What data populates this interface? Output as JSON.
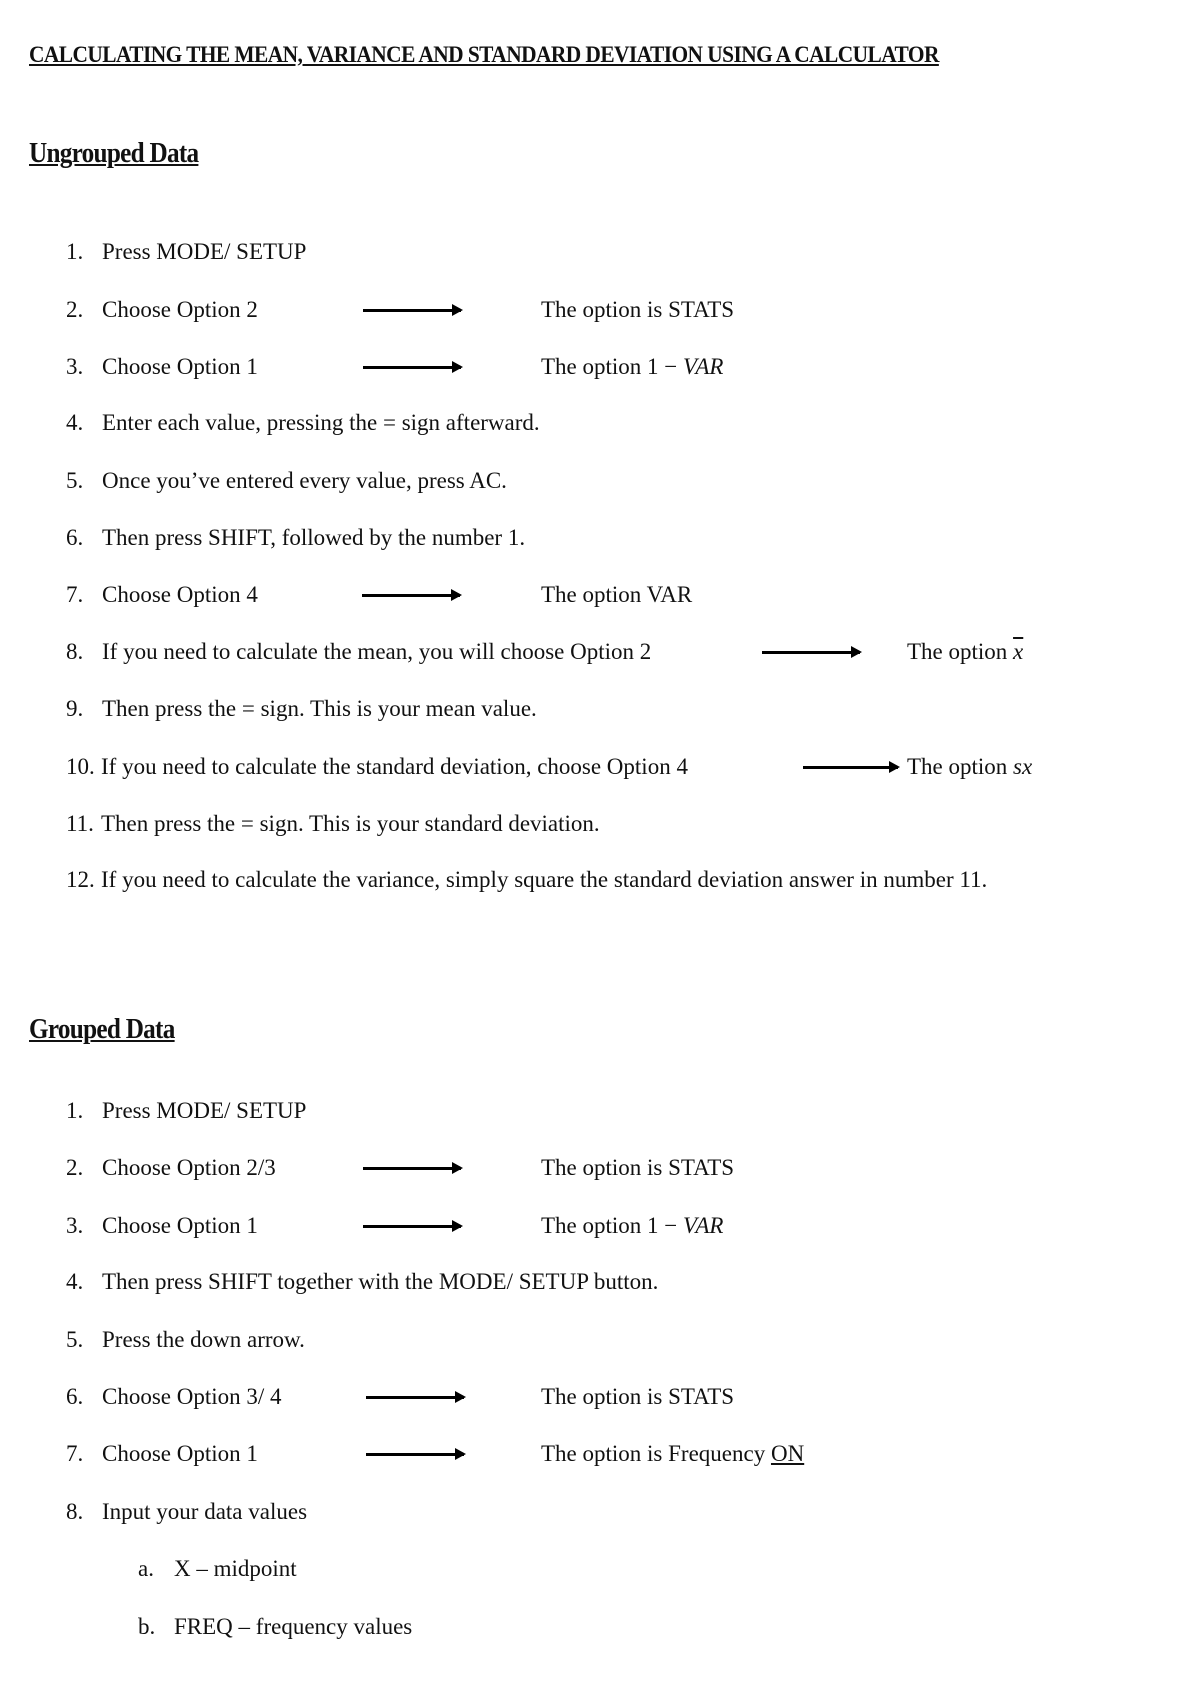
{
  "title": "CALCULATING THE MEAN, VARIANCE AND STANDARD DEVIATION USING A CALCULATOR",
  "ungrouped": {
    "heading": "Ungrouped Data",
    "steps": [
      {
        "num": "1.",
        "text": "Press MODE/ SETUP"
      },
      {
        "num": "2.",
        "text": "Choose Option 2",
        "note": "The option is STATS"
      },
      {
        "num": "3.",
        "text": "Choose Option 1",
        "note_prefix": "The option 1 − ",
        "note_italic": "VAR"
      },
      {
        "num": "4.",
        "text": "Enter each value, pressing the = sign afterward."
      },
      {
        "num": "5.",
        "text": "Once you’ve entered every value, press AC."
      },
      {
        "num": "6.",
        "text": "Then press SHIFT, followed by the number 1."
      },
      {
        "num": "7.",
        "text": "Choose Option 4",
        "note": "The option VAR"
      },
      {
        "num": "8.",
        "text": "If you need to calculate the mean, you will choose Option 2",
        "note_prefix": "The option ",
        "note_symbol": "x"
      },
      {
        "num": "9.",
        "text": "Then press the = sign. This is your mean value."
      },
      {
        "num": "10.",
        "text": "If you need to calculate the standard deviation, choose Option 4",
        "note_prefix": "The option ",
        "note_italic": "sx"
      },
      {
        "num": "11.",
        "text": "Then press the = sign. This is your standard deviation."
      },
      {
        "num": "12.",
        "text": "If you need to calculate the variance, simply square the standard deviation answer in number 11."
      }
    ]
  },
  "grouped": {
    "heading": "Grouped Data",
    "steps": [
      {
        "num": "1.",
        "text": "Press MODE/ SETUP"
      },
      {
        "num": "2.",
        "text": "Choose Option 2/3",
        "note": "The option is STATS"
      },
      {
        "num": "3.",
        "text": "Choose Option 1",
        "note_prefix": "The option 1 − ",
        "note_italic": "VAR"
      },
      {
        "num": "4.",
        "text": "Then press SHIFT together with the MODE/ SETUP button."
      },
      {
        "num": "5.",
        "text": "Press the down arrow."
      },
      {
        "num": "6.",
        "text": "Choose Option 3/ 4",
        "note": "The option is STATS"
      },
      {
        "num": "7.",
        "text": "Choose Option 1",
        "note_prefix": "The option is Frequency ",
        "note_underline": "ON"
      },
      {
        "num": "8.",
        "text": "Input your data values"
      }
    ],
    "substeps": [
      {
        "num": "a.",
        "text": "X – midpoint"
      },
      {
        "num": "b.",
        "text": "FREQ – frequency values"
      }
    ]
  }
}
